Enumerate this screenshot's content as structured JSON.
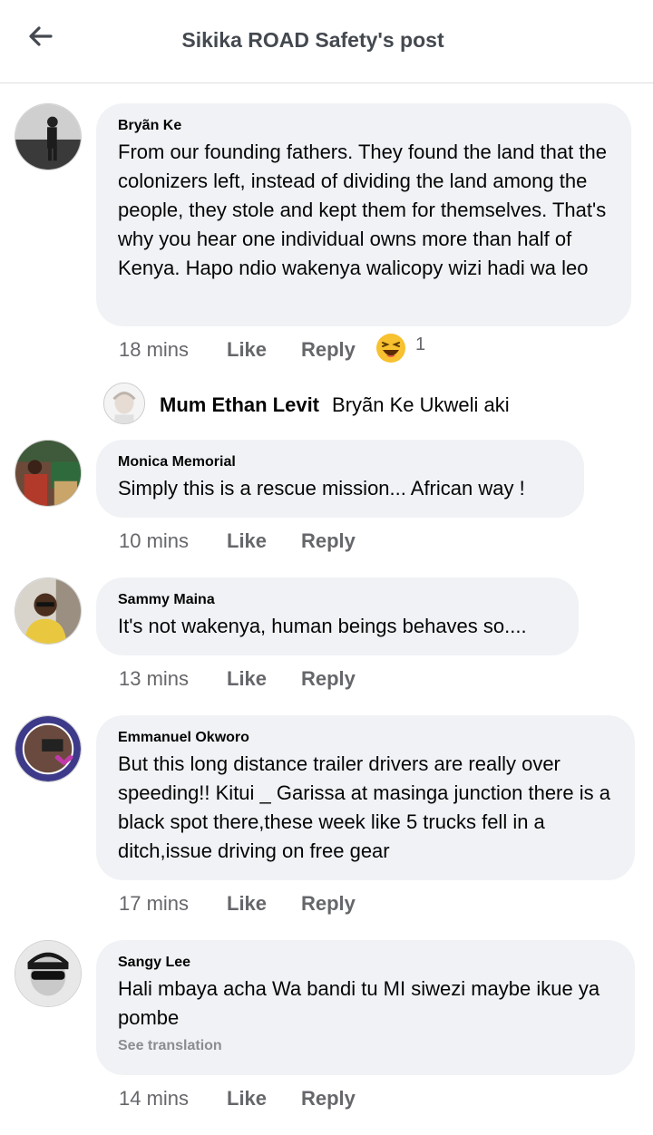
{
  "header": {
    "title": "Sikika ROAD Safety's post",
    "back_icon": "arrow-left-icon"
  },
  "comments": [
    {
      "author": "Bryãn Ke",
      "text": "From our founding fathers. They found the land that the colonizers left, instead of dividing the land among the people, they stole and kept them for themselves. That's why you hear one individual owns more than half of Kenya. Hapo ndio wakenya walicopy wizi hadi wa leo",
      "time": "18 mins",
      "like": "Like",
      "reply": "Reply",
      "reaction": {
        "icon": "haha-emoji-icon",
        "count": "1"
      },
      "replies": [
        {
          "author": "Mum Ethan Levit",
          "text": "Bryãn Ke Ukweli aki"
        }
      ]
    },
    {
      "author": "Monica Memorial",
      "text": "Simply this is a rescue mission... African way !",
      "time": "10 mins",
      "like": "Like",
      "reply": "Reply"
    },
    {
      "author": "Sammy Maina",
      "text": "It's not wakenya, human beings behaves so....",
      "time": "13 mins",
      "like": "Like",
      "reply": "Reply"
    },
    {
      "author": "Emmanuel Okworo",
      "text": "But this long distance trailer drivers are really over speeding!! Kitui _ Garissa at masinga junction there is a black spot there,these week like 5 trucks fell in a ditch,issue driving on free gear",
      "time": "17 mins",
      "like": "Like",
      "reply": "Reply"
    },
    {
      "author": "Sangy Lee",
      "text": "Hali mbaya acha Wa bandi tu MI siwezi maybe ikue ya pombe",
      "see_translation": "See translation",
      "time": "14 mins",
      "like": "Like",
      "reply": "Reply"
    }
  ]
}
